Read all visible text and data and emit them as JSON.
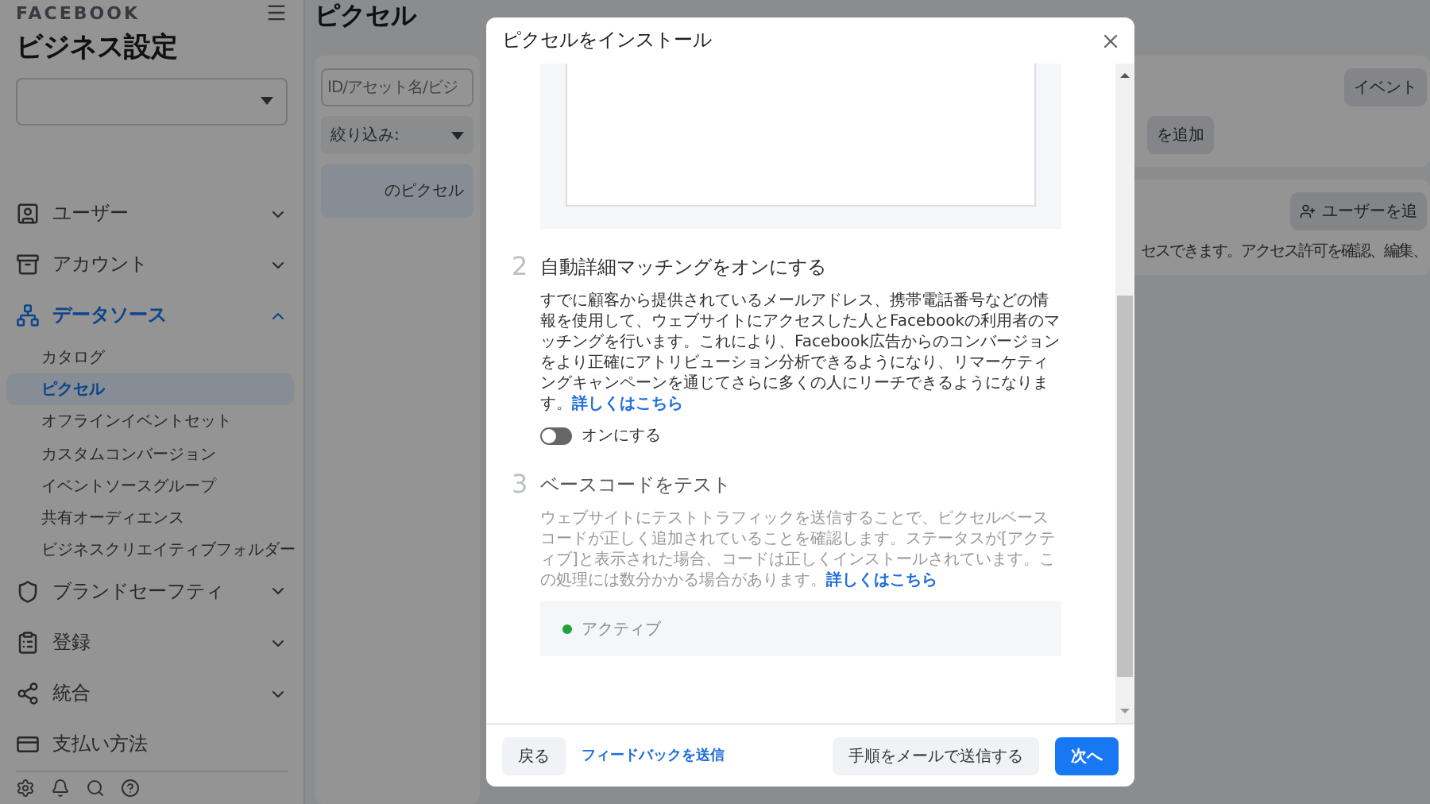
{
  "brand": "FACEBOOK",
  "sidebar_title": "ビジネス設定",
  "sidebar": {
    "items": [
      {
        "label": "ユーザー",
        "expanded": false,
        "selected": false
      },
      {
        "label": "アカウント",
        "expanded": false,
        "selected": false
      },
      {
        "label": "データソース",
        "expanded": true,
        "selected": true,
        "children": [
          {
            "label": "カタログ",
            "selected": false
          },
          {
            "label": "ピクセル",
            "selected": true
          },
          {
            "label": "オフラインイベントセット",
            "selected": false
          },
          {
            "label": "カスタムコンバージョン",
            "selected": false
          },
          {
            "label": "イベントソースグループ",
            "selected": false
          },
          {
            "label": "共有オーディエンス",
            "selected": false
          },
          {
            "label": "ビジネスクリエイティブフォルダー",
            "selected": false
          }
        ]
      },
      {
        "label": "ブランドセーフティ",
        "expanded": false,
        "selected": false
      },
      {
        "label": "登録",
        "expanded": false,
        "selected": false
      },
      {
        "label": "統合",
        "expanded": false,
        "selected": false
      },
      {
        "label": "支払い方法",
        "selected": false
      }
    ]
  },
  "page_title": "ピクセル",
  "search": {
    "placeholder": "ID/アセット名/ビジ"
  },
  "filter": {
    "label": "絞り込み:"
  },
  "list_items": [
    {
      "label": "のピクセル",
      "selected": true
    }
  ],
  "right_pane": {
    "top_button": "イベント",
    "add_button": "を追加",
    "user_button": "ユーザーを追",
    "info_text": "セスできます。アクセス許可を確認、編集、"
  },
  "modal": {
    "title": "ピクセルをインストール",
    "steps": [
      {
        "number": "2",
        "title": "自動詳細マッチングをオンにする",
        "active": true,
        "body": "すでに顧客から提供されているメールアドレス、携帯電話番号などの情報を使用して、ウェブサイトにアクセスした人とFacebookの利用者のマッチングを行います。これにより、Facebook広告からのコンバージョンをより正確にアトリビューション分析できるようになり、リマーケティングキャンペーンを通じてさらに多くの人にリーチできるようになります。",
        "link": "詳しくはこちら",
        "toggle": {
          "label": "オンにする",
          "on": false
        }
      },
      {
        "number": "3",
        "title": "ベースコードをテスト",
        "active": false,
        "body": "ウェブサイトにテストトラフィックを送信することで、ピクセルベースコードが正しく追加されていることを確認します。ステータスが[アクティブ]と表示された場合、コードは正しくインストールされています。この処理には数分かかる場合があります。",
        "link": "詳しくはこちら",
        "status": {
          "label": "アクティブ",
          "color": "#22a33a"
        }
      }
    ],
    "footer": {
      "back": "戻る",
      "feedback": "フィードバックを送信",
      "email": "手順をメールで送信する",
      "next": "次へ"
    }
  }
}
